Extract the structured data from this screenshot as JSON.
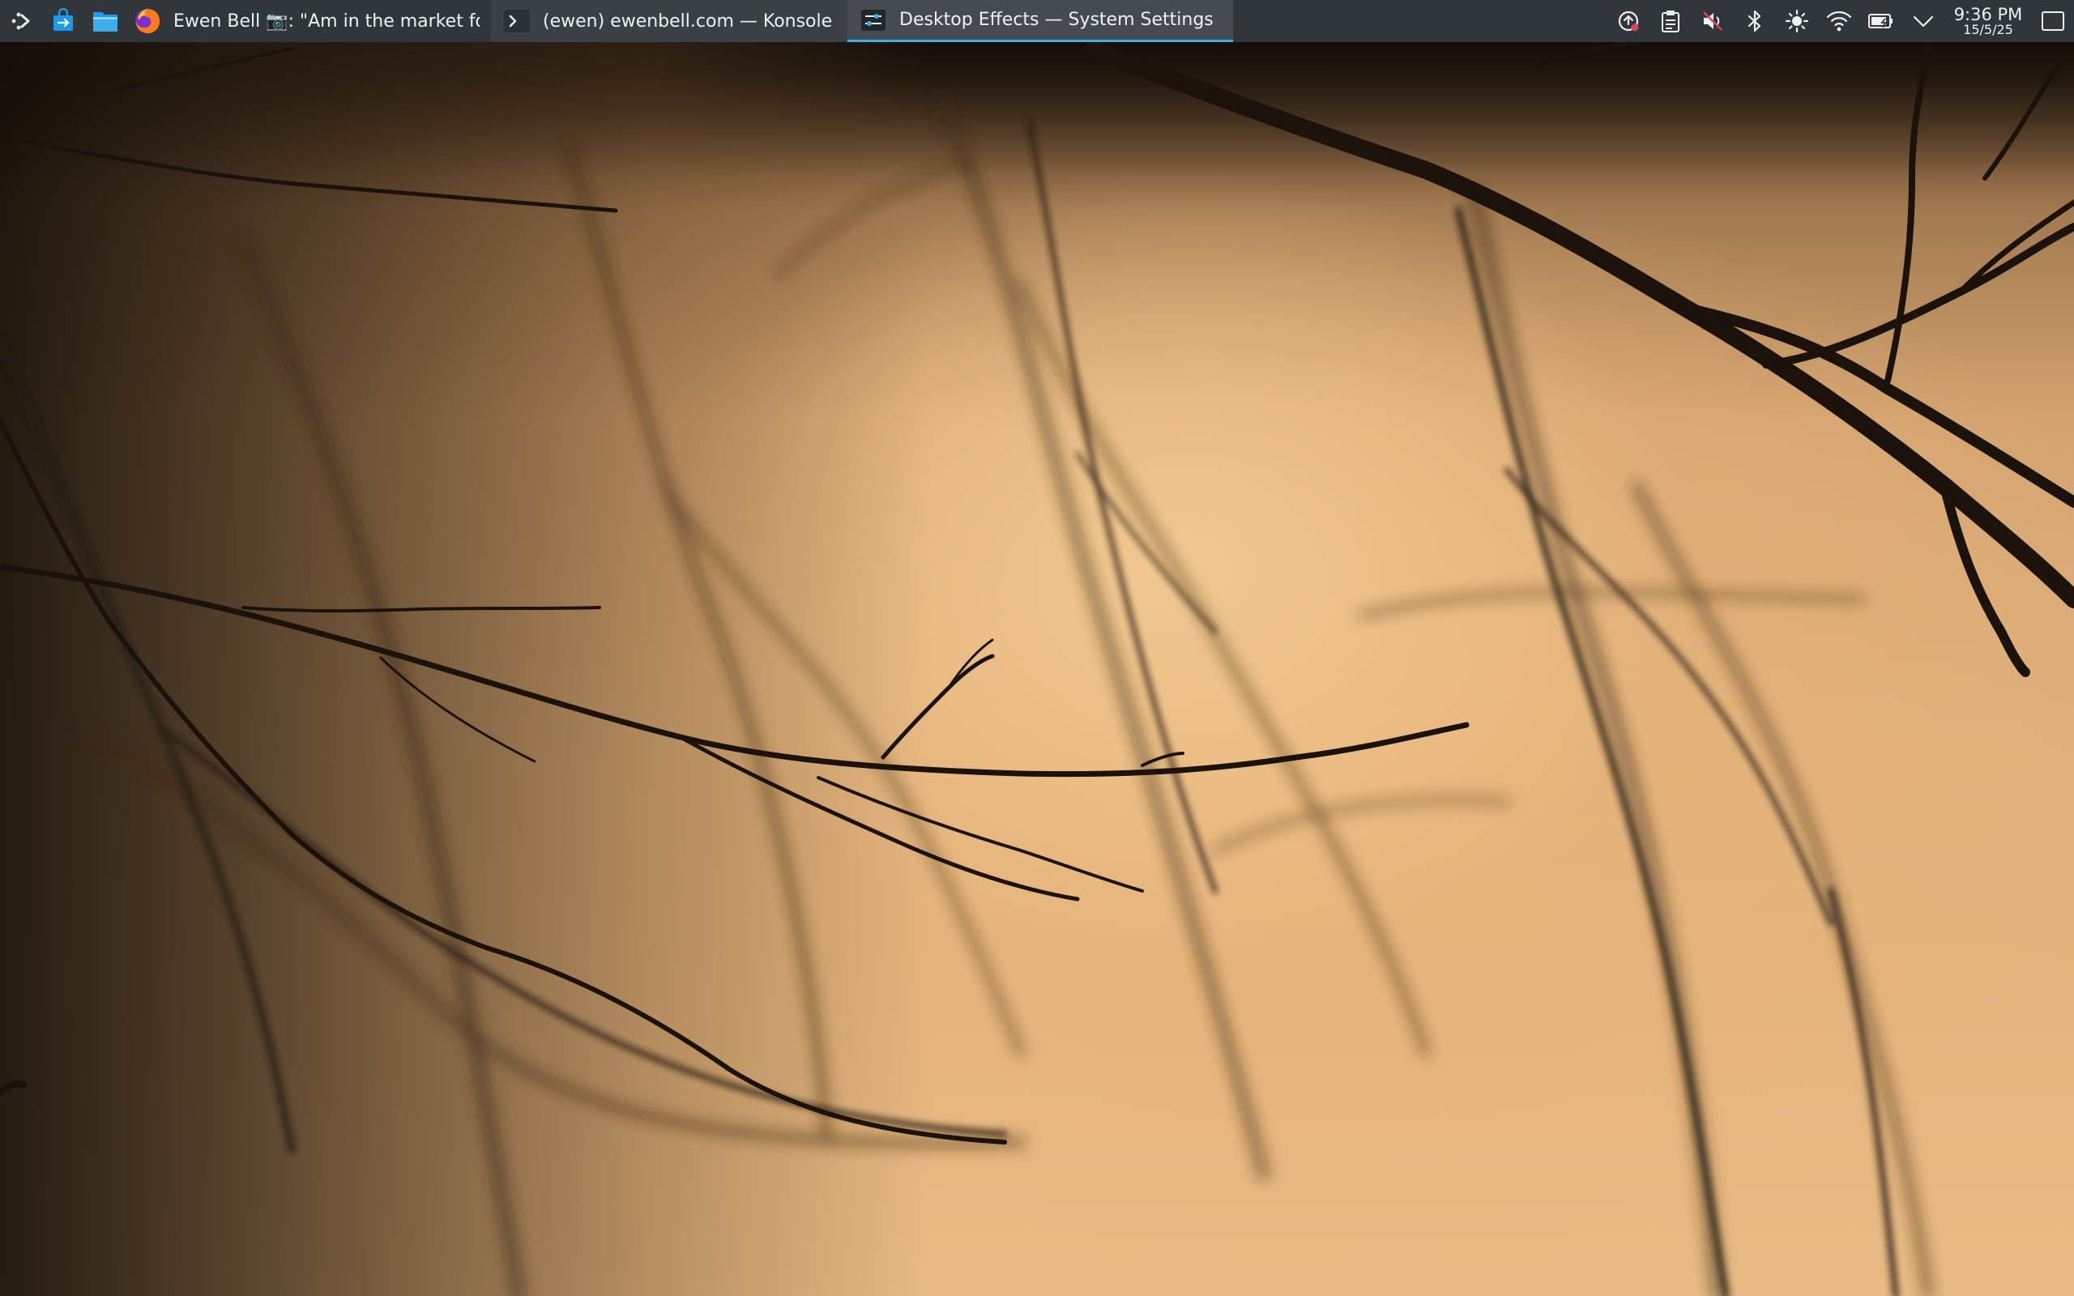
{
  "panel": {
    "launcher_icons": [
      "kde-application-menu-icon",
      "discover-store-icon",
      "dolphin-file-manager-icon"
    ],
    "tasks": [
      {
        "icon": "firefox-icon",
        "label": "Ewen Bell 📷: \"Am in the market for a bil..."
      },
      {
        "icon": "konsole-icon",
        "label": "(ewen) ewenbell.com — Konsole"
      },
      {
        "icon": "system-settings-icon",
        "label": "Desktop Effects — System Settings"
      }
    ],
    "tray_icons": [
      "update-notifier-icon",
      "clipboard-icon",
      "volume-muted-icon",
      "bluetooth-icon",
      "brightness-icon",
      "wifi-icon",
      "battery-charging-icon",
      "chevron-down-icon"
    ],
    "clock": {
      "time": "9:36 PM",
      "date": "15/5/25"
    },
    "show_desktop_icon": "show-desktop-icon"
  },
  "colors": {
    "panel_bg": "#31363b",
    "panel_text": "#eff0f1",
    "accent": "#3daee9"
  }
}
